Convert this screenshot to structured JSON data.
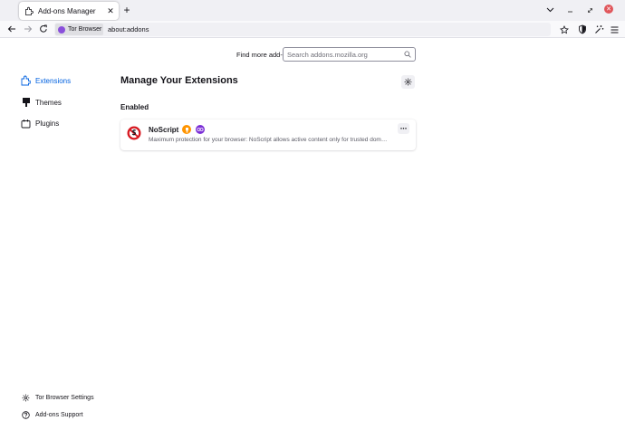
{
  "browser": {
    "tab_title": "Add-ons Manager",
    "identity_label": "Tor Browser",
    "url": "about:addons",
    "colors": {
      "accent": "#0061e0",
      "tor_purple": "#8a4fdb",
      "close_red": "#e0565b"
    }
  },
  "header": {
    "find_more_label": "Find more add-ons",
    "search_placeholder": "Search addons.mozilla.org"
  },
  "sidebar": {
    "categories": [
      {
        "label": "Extensions",
        "icon": "puzzle-icon",
        "selected": true
      },
      {
        "label": "Themes",
        "icon": "brush-icon",
        "selected": false
      },
      {
        "label": "Plugins",
        "icon": "plugin-icon",
        "selected": false
      }
    ],
    "footer": [
      {
        "label": "Tor Browser Settings",
        "icon": "gear-icon"
      },
      {
        "label": "Add-ons Support",
        "icon": "help-icon"
      }
    ]
  },
  "main": {
    "heading": "Manage Your Extensions",
    "section_enabled": "Enabled",
    "addons": [
      {
        "name": "NoScript",
        "description": "Maximum protection for your browser: NoScript allows active content only for trusted dom…",
        "badges": [
          "recommended-badge-icon",
          "private-browsing-badge-icon"
        ]
      }
    ]
  }
}
